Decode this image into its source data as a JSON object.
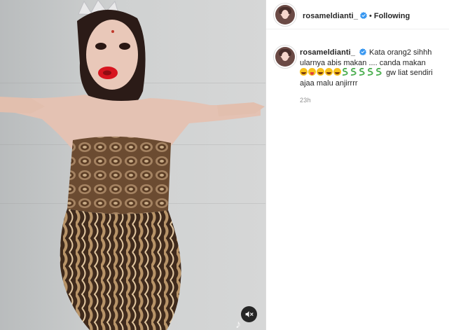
{
  "post": {
    "author": "rosameldianti_",
    "follow_status": "Following",
    "separator": "•",
    "caption_line1": "Kata orang2 sihhh ularnya abis makan .... canda makan",
    "caption_line2": "gw liat sendiri ajaa malu anjirrrr",
    "emojis": [
      "grinning-face",
      "face-with-tongue",
      "grinning-face",
      "grinning-face",
      "grinning-face",
      "snake",
      "snake",
      "snake",
      "snake",
      "snake"
    ],
    "time_ago": "23h"
  },
  "media": {
    "mute_icon": "speaker-muted-icon",
    "watermark_icon": "tiktok-icon"
  },
  "colors": {
    "verified_blue": "#3897f0",
    "text_primary": "#262626",
    "text_secondary": "#8e8e8e",
    "divider": "#dbdbdb"
  }
}
